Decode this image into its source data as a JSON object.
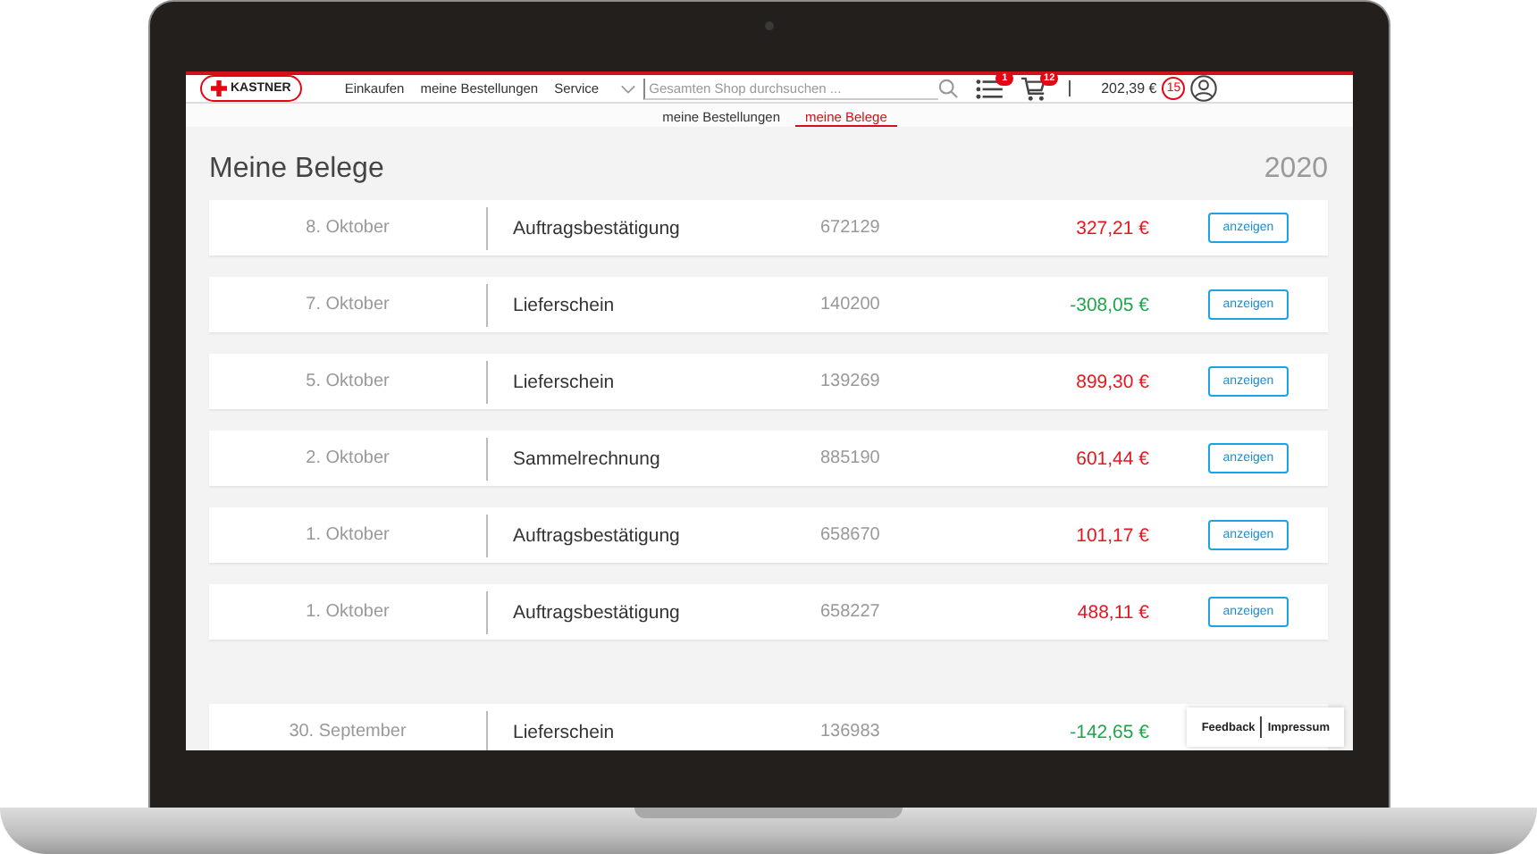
{
  "header": {
    "logo": "KASTNER",
    "nav": [
      "Einkaufen",
      "meine Bestellungen",
      "Service"
    ],
    "search": {
      "placeholder": "Gesamten Shop durchsuchen ..."
    },
    "list_badge": "1",
    "cart_badge": "12",
    "balance": "202,39 €",
    "points": "15"
  },
  "subnav": [
    {
      "label": "meine Bestellungen",
      "selected": false
    },
    {
      "label": "meine Belege",
      "selected": true
    }
  ],
  "page": {
    "title": "Meine Belege",
    "year": "2020"
  },
  "documents": [
    {
      "date": "8. Oktober",
      "type": "Auftragsbestätigung",
      "number": "672129",
      "amount": "327,21 €",
      "color": "#e8141e",
      "action": "anzeigen"
    },
    {
      "date": "7. Oktober",
      "type": "Lieferschein",
      "number": "140200",
      "amount": "-308,05 €",
      "color": "#1fa54a",
      "action": "anzeigen"
    },
    {
      "date": "5. Oktober",
      "type": "Lieferschein",
      "number": "139269",
      "amount": "899,30 €",
      "color": "#e8141e",
      "action": "anzeigen"
    },
    {
      "date": "2. Oktober",
      "type": "Sammelrechnung",
      "number": "885190",
      "amount": "601,44 €",
      "color": "#e8141e",
      "action": "anzeigen"
    },
    {
      "date": "1. Oktober",
      "type": "Auftragsbestätigung",
      "number": "658670",
      "amount": "101,17 €",
      "color": "#e8141e",
      "action": "anzeigen"
    },
    {
      "date": "1. Oktober",
      "type": "Auftragsbestätigung",
      "number": "658227",
      "amount": "488,11 €",
      "color": "#e8141e",
      "action": "anzeigen"
    }
  ],
  "next_documents": [
    {
      "date": "30. September",
      "type": "Lieferschein",
      "number": "136983",
      "amount": "-142,65 €",
      "color": "#1fa54a"
    }
  ],
  "footer_links": [
    "Feedback",
    "Impressum"
  ]
}
